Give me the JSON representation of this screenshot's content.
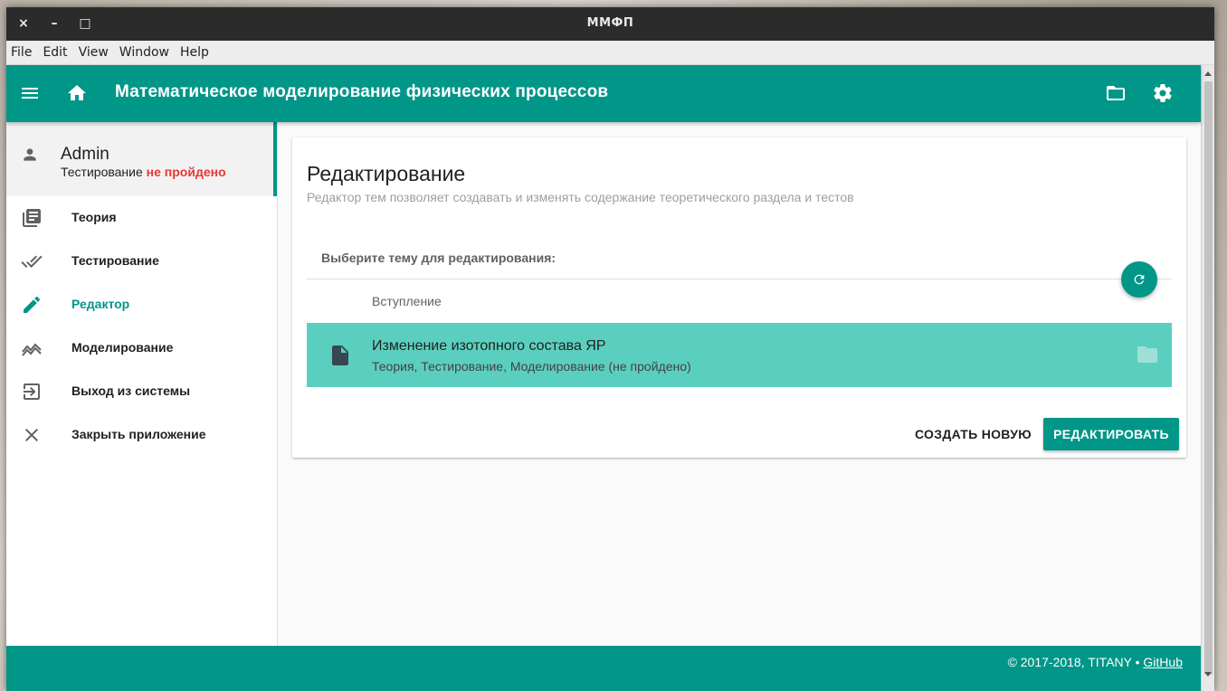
{
  "window": {
    "title": "ММФП",
    "close_glyph": "×",
    "minimize_glyph": "–",
    "maximize_glyph": "□"
  },
  "menubar": {
    "items": [
      "File",
      "Edit",
      "View",
      "Window",
      "Help"
    ]
  },
  "appbar": {
    "title": "Математическое моделирование физических процессов",
    "icons": [
      "menu-icon",
      "home-icon",
      "folder-icon",
      "settings-icon"
    ]
  },
  "user": {
    "name": "Admin",
    "status_prefix": "Тестирование",
    "status_value": "не пройдено",
    "status_color": "#e53935"
  },
  "nav": {
    "items": [
      {
        "label": "Теория",
        "icon": "book-icon",
        "active": false
      },
      {
        "label": "Тестирование",
        "icon": "double-check-icon",
        "active": false
      },
      {
        "label": "Редактор",
        "icon": "pencil-icon",
        "active": true
      },
      {
        "label": "Моделирование",
        "icon": "chart-line-icon",
        "active": false
      },
      {
        "label": "Выход из системы",
        "icon": "logout-icon",
        "active": false
      },
      {
        "label": "Закрыть приложение",
        "icon": "close-icon",
        "active": false
      }
    ]
  },
  "editor": {
    "title": "Редактирование",
    "subtitle": "Редактор тем позволяет создавать и изменять содержание теоретического раздела и тестов",
    "pick_label": "Выберите тему для редактирования:",
    "topics": [
      {
        "title": "Вступление",
        "selected": false
      },
      {
        "title": "Изменение изотопного состава ЯР",
        "subtitle": "Теория, Тестирование, Моделирование (не пройдено)",
        "selected": true
      }
    ],
    "create_label": "СОЗДАТЬ НОВУЮ",
    "edit_label": "РЕДАКТИРОВАТЬ"
  },
  "footer": {
    "copyright": "© 2017-2018, TITANY •",
    "github_label": "GitHub"
  },
  "colors": {
    "primary": "#009688",
    "selected_row": "#5bcfbf",
    "error": "#e53935"
  }
}
